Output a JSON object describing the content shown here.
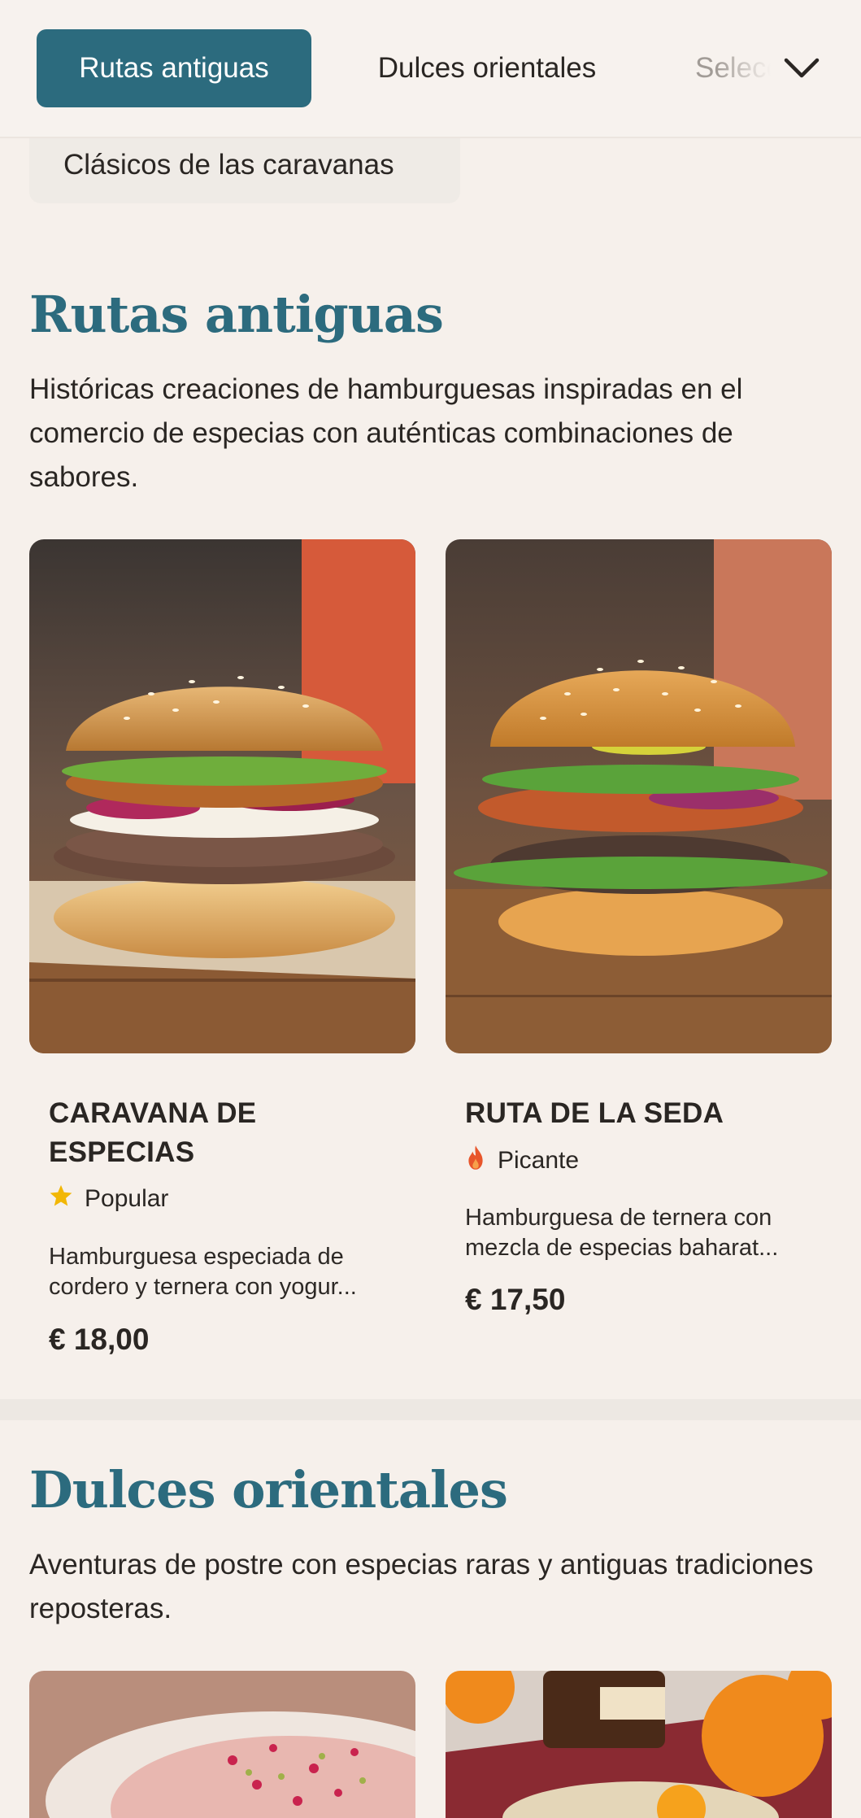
{
  "nav": {
    "tabs": [
      {
        "label": "Rutas antiguas",
        "active": true
      },
      {
        "label": "Dulces orientales",
        "active": false
      },
      {
        "label": "Selecciones",
        "active": false
      }
    ],
    "second_row": [
      "Clásicos de las caravanas"
    ],
    "expand_icon": "chevron-down-icon"
  },
  "sections": [
    {
      "title": "Rutas antiguas",
      "description": "Históricas creaciones de hamburguesas inspiradas en el comercio de especias con auténticas combinaciones de sabores.",
      "items": [
        {
          "name": "CARAVANA DE ESPECIAS",
          "badge": "Popular",
          "badge_icon": "star-icon",
          "description": "Hamburguesa especiada de cordero y ternera con yogur...",
          "price": "€ 18,00"
        },
        {
          "name": "RUTA DE LA SEDA",
          "badge": "Picante",
          "badge_icon": "flame-icon",
          "description": "Hamburguesa de ternera con mezcla de especias baharat...",
          "price": "€ 17,50"
        }
      ]
    },
    {
      "title": "Dulces orientales",
      "description": "Aventuras de postre con especias raras y antiguas tradiciones reposteras."
    }
  ],
  "colors": {
    "accent": "#2c6b7e",
    "background": "#f6f0eb",
    "star": "#f2b705",
    "flame": "#e8552a"
  }
}
